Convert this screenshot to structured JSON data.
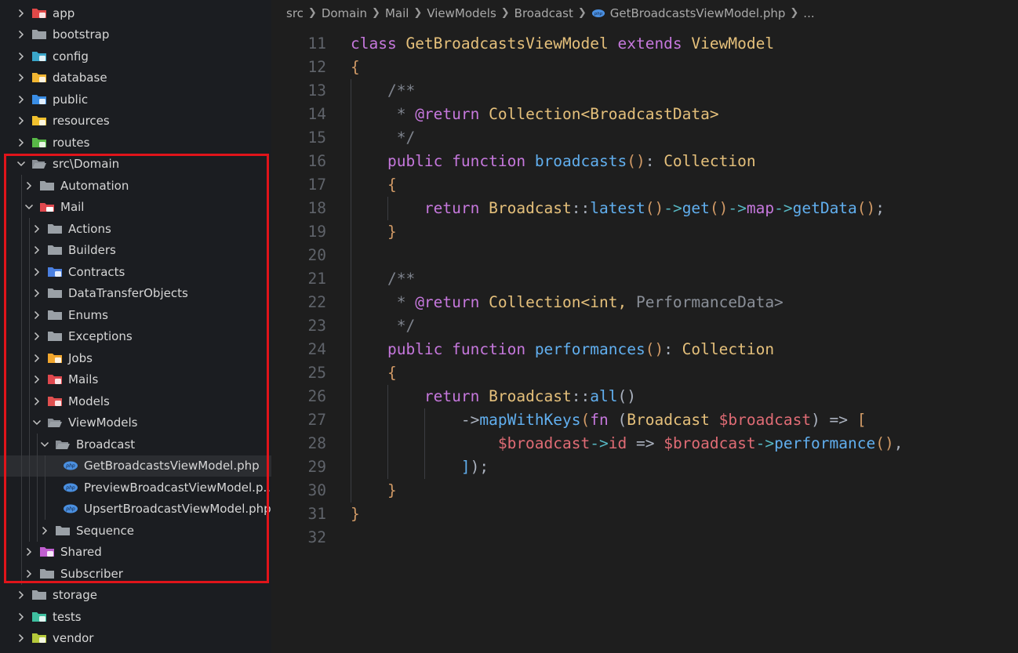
{
  "sidebar": {
    "items": [
      {
        "label": "app",
        "depth": 0,
        "expanded": false,
        "icon": "app-folder-icon",
        "iconColor": "#e04848"
      },
      {
        "label": "bootstrap",
        "depth": 0,
        "expanded": false,
        "icon": "folder-icon",
        "iconColor": "#9aa0a6"
      },
      {
        "label": "config",
        "depth": 0,
        "expanded": false,
        "icon": "config-folder-icon",
        "iconColor": "#3aa6c9"
      },
      {
        "label": "database",
        "depth": 0,
        "expanded": false,
        "icon": "database-folder-icon",
        "iconColor": "#f2b632"
      },
      {
        "label": "public",
        "depth": 0,
        "expanded": false,
        "icon": "public-folder-icon",
        "iconColor": "#3a8ee6"
      },
      {
        "label": "resources",
        "depth": 0,
        "expanded": false,
        "icon": "resources-folder-icon",
        "iconColor": "#f2c12e"
      },
      {
        "label": "routes",
        "depth": 0,
        "expanded": false,
        "icon": "routes-folder-icon",
        "iconColor": "#58b947"
      },
      {
        "label": "src\\Domain",
        "depth": 0,
        "expanded": true,
        "icon": "open-folder-icon",
        "iconColor": "#9aa0a6"
      },
      {
        "label": "Automation",
        "depth": 1,
        "expanded": false,
        "icon": "folder-icon",
        "iconColor": "#9aa0a6"
      },
      {
        "label": "Mail",
        "depth": 1,
        "expanded": true,
        "icon": "mail-folder-icon",
        "iconColor": "#e0484e"
      },
      {
        "label": "Actions",
        "depth": 2,
        "expanded": false,
        "icon": "folder-icon",
        "iconColor": "#9aa0a6"
      },
      {
        "label": "Builders",
        "depth": 2,
        "expanded": false,
        "icon": "folder-icon",
        "iconColor": "#9aa0a6"
      },
      {
        "label": "Contracts",
        "depth": 2,
        "expanded": false,
        "icon": "contracts-folder-icon",
        "iconColor": "#4a7fe0"
      },
      {
        "label": "DataTransferObjects",
        "depth": 2,
        "expanded": false,
        "icon": "folder-icon",
        "iconColor": "#9aa0a6"
      },
      {
        "label": "Enums",
        "depth": 2,
        "expanded": false,
        "icon": "folder-icon",
        "iconColor": "#9aa0a6"
      },
      {
        "label": "Exceptions",
        "depth": 2,
        "expanded": false,
        "icon": "folder-icon",
        "iconColor": "#9aa0a6"
      },
      {
        "label": "Jobs",
        "depth": 2,
        "expanded": false,
        "icon": "jobs-folder-icon",
        "iconColor": "#f2a72e"
      },
      {
        "label": "Mails",
        "depth": 2,
        "expanded": false,
        "icon": "mails-folder-icon",
        "iconColor": "#e0484e"
      },
      {
        "label": "Models",
        "depth": 2,
        "expanded": false,
        "icon": "models-folder-icon",
        "iconColor": "#e05050"
      },
      {
        "label": "ViewModels",
        "depth": 2,
        "expanded": true,
        "icon": "open-folder-icon",
        "iconColor": "#9aa0a6"
      },
      {
        "label": "Broadcast",
        "depth": 3,
        "expanded": true,
        "icon": "open-folder-icon",
        "iconColor": "#9aa0a6"
      },
      {
        "label": "GetBroadcastsViewModel.php",
        "depth": 4,
        "file": true,
        "selected": true,
        "icon": "php-file-icon",
        "iconColor": "#4a8fe0"
      },
      {
        "label": "PreviewBroadcastViewModel.p...",
        "depth": 4,
        "file": true,
        "icon": "php-file-icon",
        "iconColor": "#4a8fe0"
      },
      {
        "label": "UpsertBroadcastViewModel.php",
        "depth": 4,
        "file": true,
        "icon": "php-file-icon",
        "iconColor": "#4a8fe0"
      },
      {
        "label": "Sequence",
        "depth": 3,
        "expanded": false,
        "icon": "folder-icon",
        "iconColor": "#9aa0a6"
      },
      {
        "label": "Shared",
        "depth": 1,
        "expanded": false,
        "icon": "shared-folder-icon",
        "iconColor": "#c05ed0"
      },
      {
        "label": "Subscriber",
        "depth": 1,
        "expanded": false,
        "icon": "folder-icon",
        "iconColor": "#9aa0a6"
      },
      {
        "label": "storage",
        "depth": 0,
        "expanded": false,
        "icon": "folder-icon",
        "iconColor": "#9aa0a6"
      },
      {
        "label": "tests",
        "depth": 0,
        "expanded": false,
        "icon": "tests-folder-icon",
        "iconColor": "#3ec0a0"
      },
      {
        "label": "vendor",
        "depth": 0,
        "expanded": false,
        "icon": "vendor-folder-icon",
        "iconColor": "#b5c93a"
      }
    ],
    "highlightColor": "#e0141a"
  },
  "breadcrumb": {
    "parts": [
      "src",
      "Domain",
      "Mail",
      "ViewModels",
      "Broadcast"
    ],
    "file": "GetBroadcastsViewModel.php",
    "ellipsis": "..."
  },
  "editor": {
    "colors": {
      "keyword": "#c678dd",
      "className": "#e5c07b",
      "brace": "#d19a66",
      "comment": "#7f848e",
      "function": "#61afef",
      "plain": "#abb2bf",
      "variable": "#e06c75",
      "operator": "#56b6c2",
      "genericMuted": "#8a8f98"
    },
    "lines": [
      {
        "n": "11",
        "tokens": [
          [
            "class ",
            "keyword"
          ],
          [
            "GetBroadcastsViewModel ",
            "className"
          ],
          [
            "extends ",
            "keyword"
          ],
          [
            "ViewModel",
            "className"
          ]
        ]
      },
      {
        "n": "12",
        "tokens": [
          [
            "{",
            "brace"
          ]
        ]
      },
      {
        "n": "13",
        "tokens": [
          [
            "    /**",
            "comment"
          ]
        ]
      },
      {
        "n": "14",
        "tokens": [
          [
            "     * ",
            "comment"
          ],
          [
            "@return ",
            "keyword"
          ],
          [
            "Collection<BroadcastData>",
            "className"
          ]
        ]
      },
      {
        "n": "15",
        "tokens": [
          [
            "     */",
            "comment"
          ]
        ]
      },
      {
        "n": "16",
        "tokens": [
          [
            "    public function ",
            "keyword"
          ],
          [
            "broadcasts",
            "function"
          ],
          [
            "()",
            "brace"
          ],
          [
            ": ",
            "plain"
          ],
          [
            "Collection",
            "className"
          ]
        ]
      },
      {
        "n": "17",
        "tokens": [
          [
            "    {",
            "brace"
          ]
        ]
      },
      {
        "n": "18",
        "tokens": [
          [
            "        return ",
            "keyword"
          ],
          [
            "Broadcast",
            "className"
          ],
          [
            "::",
            "plain"
          ],
          [
            "latest",
            "function"
          ],
          [
            "()",
            "brace"
          ],
          [
            "->",
            "operator"
          ],
          [
            "get",
            "function"
          ],
          [
            "()",
            "brace"
          ],
          [
            "->",
            "operator"
          ],
          [
            "map",
            "keyword"
          ],
          [
            "->",
            "operator"
          ],
          [
            "getData",
            "function"
          ],
          [
            "()",
            "brace"
          ],
          [
            ";",
            "plain"
          ]
        ]
      },
      {
        "n": "19",
        "tokens": [
          [
            "    }",
            "brace"
          ]
        ]
      },
      {
        "n": "20",
        "tokens": []
      },
      {
        "n": "21",
        "tokens": [
          [
            "    /**",
            "comment"
          ]
        ]
      },
      {
        "n": "22",
        "tokens": [
          [
            "     * ",
            "comment"
          ],
          [
            "@return ",
            "keyword"
          ],
          [
            "Collection<int, ",
            "className"
          ],
          [
            "PerformanceData>",
            "genericMuted"
          ]
        ]
      },
      {
        "n": "23",
        "tokens": [
          [
            "     */",
            "comment"
          ]
        ]
      },
      {
        "n": "24",
        "tokens": [
          [
            "    public function ",
            "keyword"
          ],
          [
            "performances",
            "function"
          ],
          [
            "()",
            "brace"
          ],
          [
            ": ",
            "plain"
          ],
          [
            "Collection",
            "className"
          ]
        ]
      },
      {
        "n": "25",
        "tokens": [
          [
            "    {",
            "brace"
          ]
        ]
      },
      {
        "n": "26",
        "tokens": [
          [
            "        return ",
            "keyword"
          ],
          [
            "Broadcast",
            "className"
          ],
          [
            "::",
            "plain"
          ],
          [
            "all",
            "function"
          ],
          [
            "()",
            "plain"
          ]
        ]
      },
      {
        "n": "27",
        "tokens": [
          [
            "            ->",
            "plain"
          ],
          [
            "mapWithKeys",
            "function"
          ],
          [
            "(",
            "brace"
          ],
          [
            "fn ",
            "keyword"
          ],
          [
            "(",
            "plain"
          ],
          [
            "Broadcast ",
            "className"
          ],
          [
            "$broadcast",
            "variable"
          ],
          [
            ") ",
            "plain"
          ],
          [
            "=> ",
            "plain"
          ],
          [
            "[",
            "brace"
          ]
        ]
      },
      {
        "n": "28",
        "tokens": [
          [
            "                $broadcast",
            "variable"
          ],
          [
            "->",
            "operator"
          ],
          [
            "id ",
            "variable"
          ],
          [
            "=> ",
            "plain"
          ],
          [
            "$broadcast",
            "variable"
          ],
          [
            "->",
            "operator"
          ],
          [
            "performance",
            "function"
          ],
          [
            "()",
            "brace"
          ],
          [
            ",",
            "plain"
          ]
        ]
      },
      {
        "n": "29",
        "tokens": [
          [
            "            ]",
            "function"
          ],
          [
            ");",
            "plain"
          ]
        ]
      },
      {
        "n": "30",
        "tokens": [
          [
            "    }",
            "brace"
          ]
        ]
      },
      {
        "n": "31",
        "tokens": [
          [
            "}",
            "brace"
          ]
        ]
      },
      {
        "n": "32",
        "tokens": []
      }
    ]
  }
}
